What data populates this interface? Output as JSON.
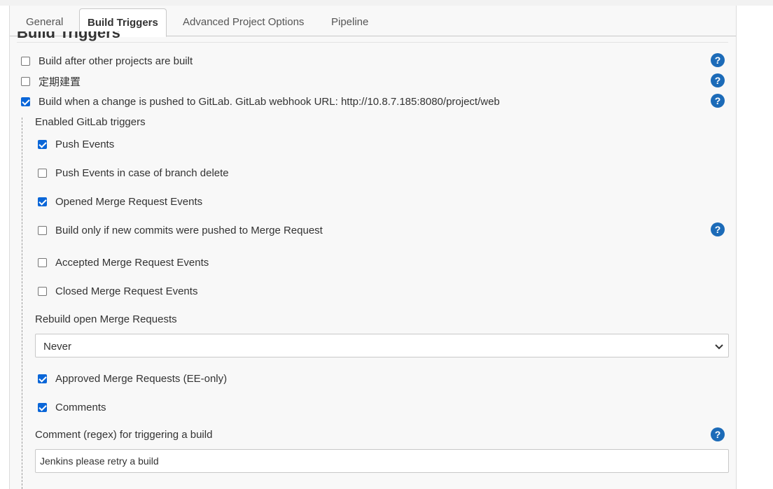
{
  "tabs": {
    "general": "General",
    "build_triggers": "Build Triggers",
    "advanced": "Advanced Project Options",
    "pipeline": "Pipeline"
  },
  "section": {
    "title": "Build Triggers"
  },
  "triggers": {
    "after_other_projects": {
      "label": "Build after other projects are built",
      "checked": false
    },
    "periodic": {
      "label": "定期建置",
      "checked": false
    },
    "gitlab_push": {
      "label": "Build when a change is pushed to GitLab. GitLab webhook URL: http://10.8.7.185:8080/project/web",
      "checked": true
    }
  },
  "gitlab": {
    "enabled_triggers_label": "Enabled GitLab triggers",
    "push_events": {
      "label": "Push Events",
      "checked": true
    },
    "push_branch_delete": {
      "label": "Push Events in case of branch delete",
      "checked": false
    },
    "opened_mr": {
      "label": "Opened Merge Request Events",
      "checked": true
    },
    "new_commits_only": {
      "label": "Build only if new commits were pushed to Merge Request",
      "checked": false
    },
    "accepted_mr": {
      "label": "Accepted Merge Request Events",
      "checked": false
    },
    "closed_mr": {
      "label": "Closed Merge Request Events",
      "checked": false
    },
    "rebuild_label": "Rebuild open Merge Requests",
    "rebuild_value": "Never",
    "approved_mr": {
      "label": "Approved Merge Requests (EE-only)",
      "checked": true
    },
    "comments": {
      "label": "Comments",
      "checked": true
    },
    "comment_regex_label": "Comment (regex) for triggering a build",
    "comment_regex_value": "Jenkins please retry a build"
  },
  "icons": {
    "help": "help-circle-icon",
    "select": "chevron-down-icon"
  },
  "colors": {
    "accent": "#0a66d8",
    "help": "#1c6bb8"
  }
}
